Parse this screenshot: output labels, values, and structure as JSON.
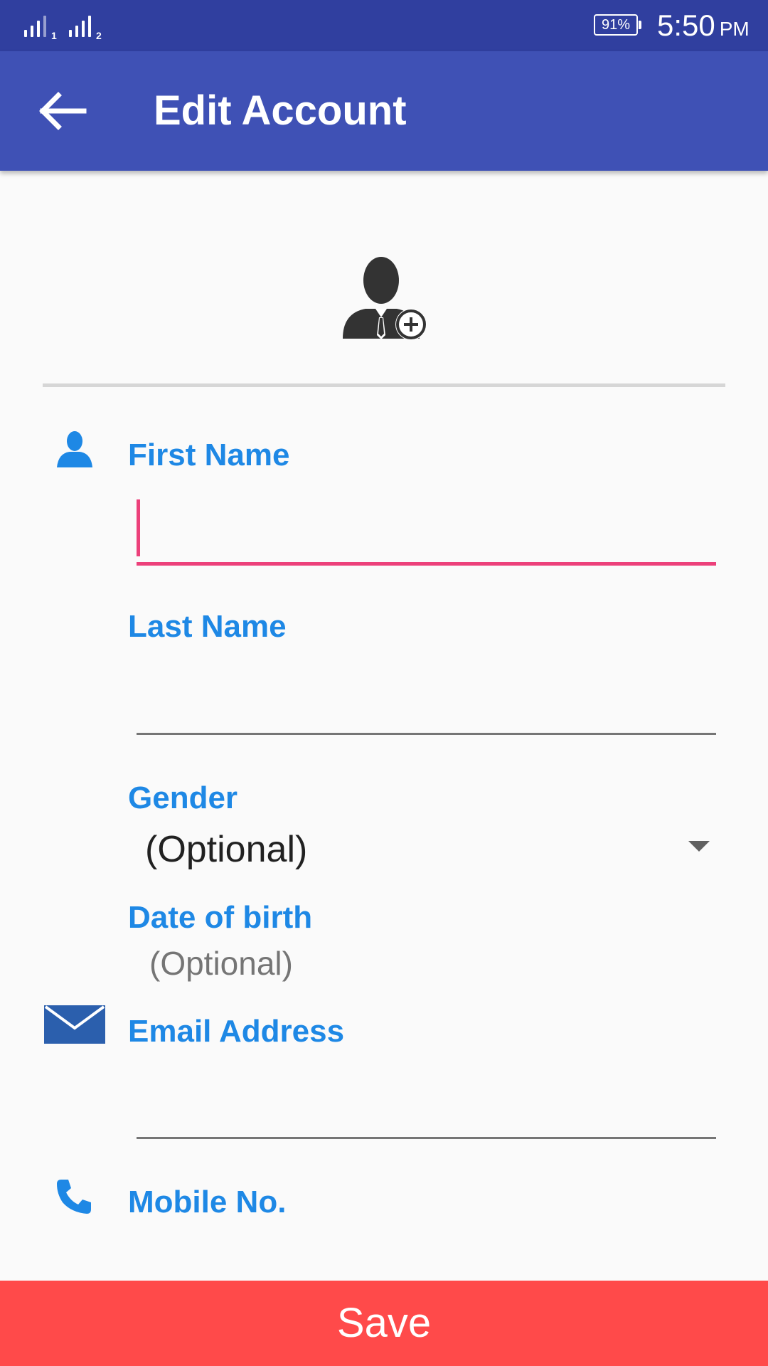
{
  "status_bar": {
    "sim1_label": "1",
    "sim2_label": "2",
    "battery": "91%",
    "time": "5:50",
    "ampm": "PM"
  },
  "app_bar": {
    "title": "Edit Account",
    "back_icon": "arrow-left-icon"
  },
  "avatar": {
    "icon": "add-user-photo-icon"
  },
  "form": {
    "first_name": {
      "label": "First Name",
      "value": "",
      "icon": "person-icon",
      "focused": true
    },
    "last_name": {
      "label": "Last Name",
      "value": ""
    },
    "gender": {
      "label": "Gender",
      "selected": "(Optional)"
    },
    "dob": {
      "label": "Date of birth",
      "value": "(Optional)"
    },
    "email": {
      "label": "Email Address",
      "value": "",
      "icon": "envelope-icon"
    },
    "mobile": {
      "label": "Mobile No.",
      "icon": "phone-icon"
    }
  },
  "save_button": {
    "label": "Save"
  },
  "colors": {
    "status_bar": "#303f9f",
    "app_bar": "#3f51b5",
    "label": "#1e88e5",
    "focus": "#ec407a",
    "save": "#ff4a4a"
  }
}
